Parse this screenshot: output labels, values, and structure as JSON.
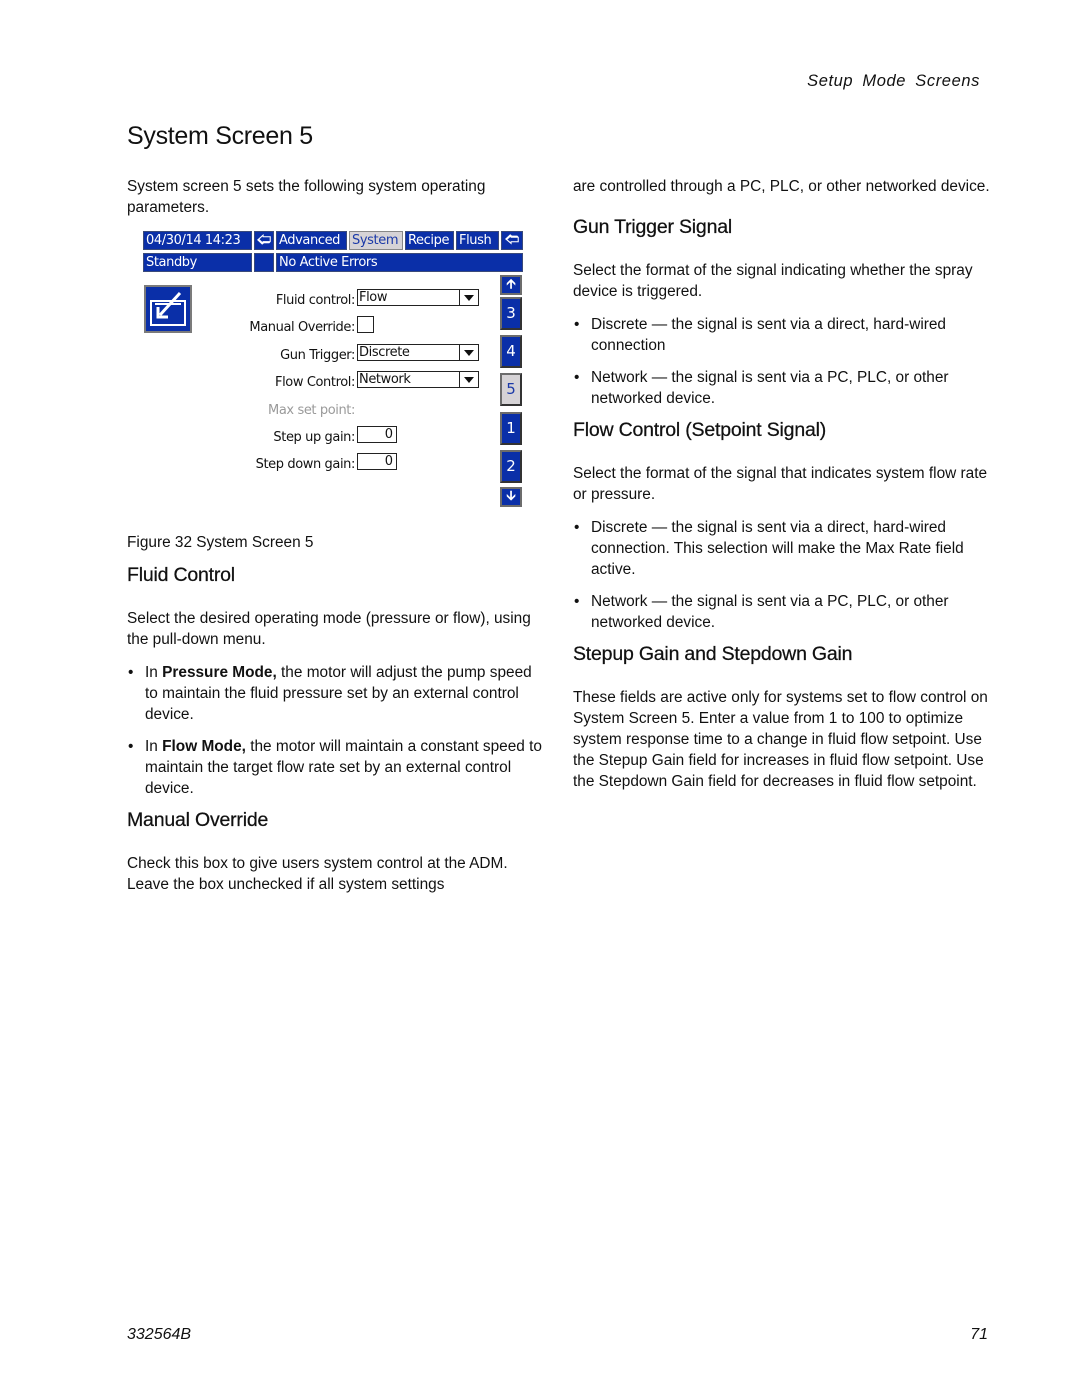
{
  "header": {
    "running_head": "Setup  Mode  Screens",
    "title": "System Screen 5"
  },
  "left_column": {
    "intro": "System screen 5 sets the following system operating parameters.",
    "screen": {
      "top_bar": {
        "datetime": "04/30/14  14:23",
        "prev_icon": "left-arrow-icon",
        "tabs": [
          {
            "label": "Advanced",
            "active": false
          },
          {
            "label": "System",
            "active": true
          },
          {
            "label": "Recipe",
            "active": false
          },
          {
            "label": "Flush",
            "active": false
          }
        ],
        "next_icon": "right-arrow-icon"
      },
      "status_bar": {
        "state": "Standby",
        "errors": "No Active Errors"
      },
      "setup_icon": "edit-setup-icon",
      "fields": {
        "fluid_control": {
          "label": "Fluid control:",
          "value": "Flow"
        },
        "manual_override": {
          "label": "Manual Override:",
          "checked": false
        },
        "gun_trigger": {
          "label": "Gun Trigger:",
          "value": "Discrete"
        },
        "flow_control": {
          "label": "Flow Control:",
          "value": "Network"
        },
        "max_set_point": {
          "label": "Max set point:",
          "disabled": true
        },
        "step_up_gain": {
          "label": "Step up gain:",
          "value": "0"
        },
        "step_down_gain": {
          "label": "Step down gain:",
          "value": "0"
        }
      },
      "side_nav": {
        "up_icon": "up-arrow-icon",
        "pages": [
          {
            "label": "3",
            "active": false
          },
          {
            "label": "4",
            "active": false
          },
          {
            "label": "5",
            "active": true
          },
          {
            "label": "1",
            "active": false
          },
          {
            "label": "2",
            "active": false
          }
        ],
        "down_icon": "down-arrow-icon"
      }
    },
    "caption": "Figure 32  System Screen 5",
    "fluid_control": {
      "heading": "Fluid Control",
      "body": "Select the desired operating mode (pressure or flow), using the pull-down menu.",
      "bullets": [
        {
          "bold": "Pressure Mode,",
          "prefix": "In ",
          "text": " the motor will adjust the pump speed to maintain the fluid pressure set by an external control device."
        },
        {
          "bold": "Flow Mode,",
          "prefix": "In ",
          "text": " the motor will maintain a constant speed to maintain the target flow rate set by an external control device."
        }
      ]
    },
    "manual_override": {
      "heading": "Manual Override",
      "body": "Check this box to give users system control at the ADM. Leave the box unchecked if all system settings"
    }
  },
  "right_column": {
    "continued": "are controlled through a PC, PLC, or other networked device.",
    "gun_trigger": {
      "heading": "Gun Trigger Signal",
      "body": "Select the format of the signal indicating whether the spray device is triggered.",
      "bullets": [
        "Discrete — the signal is sent via a direct, hard-wired connection",
        "Network — the signal is sent via a PC, PLC, or other networked device."
      ]
    },
    "flow_control": {
      "heading": "Flow Control (Setpoint Signal)",
      "body": "Select the format of the signal that indicates system flow rate or pressure.",
      "bullets": [
        "Discrete — the signal is sent via a direct, hard-wired connection.  This selection will make the Max Rate field active.",
        "Network — the signal is sent via a PC, PLC, or other networked device."
      ]
    },
    "gain": {
      "heading": "Stepup Gain and Stepdown Gain",
      "body": "These fields are active only for systems set to flow control on System Screen 5.  Enter a value from 1 to 100 to optimize system response time to a change in fluid flow setpoint.  Use the Stepup Gain field for increases in fluid flow setpoint.  Use the Stepdown Gain field for decreases in fluid flow setpoint."
    }
  },
  "footer": {
    "doc_number": "332564B",
    "page_number": "71"
  },
  "bullet_glyph": "•"
}
